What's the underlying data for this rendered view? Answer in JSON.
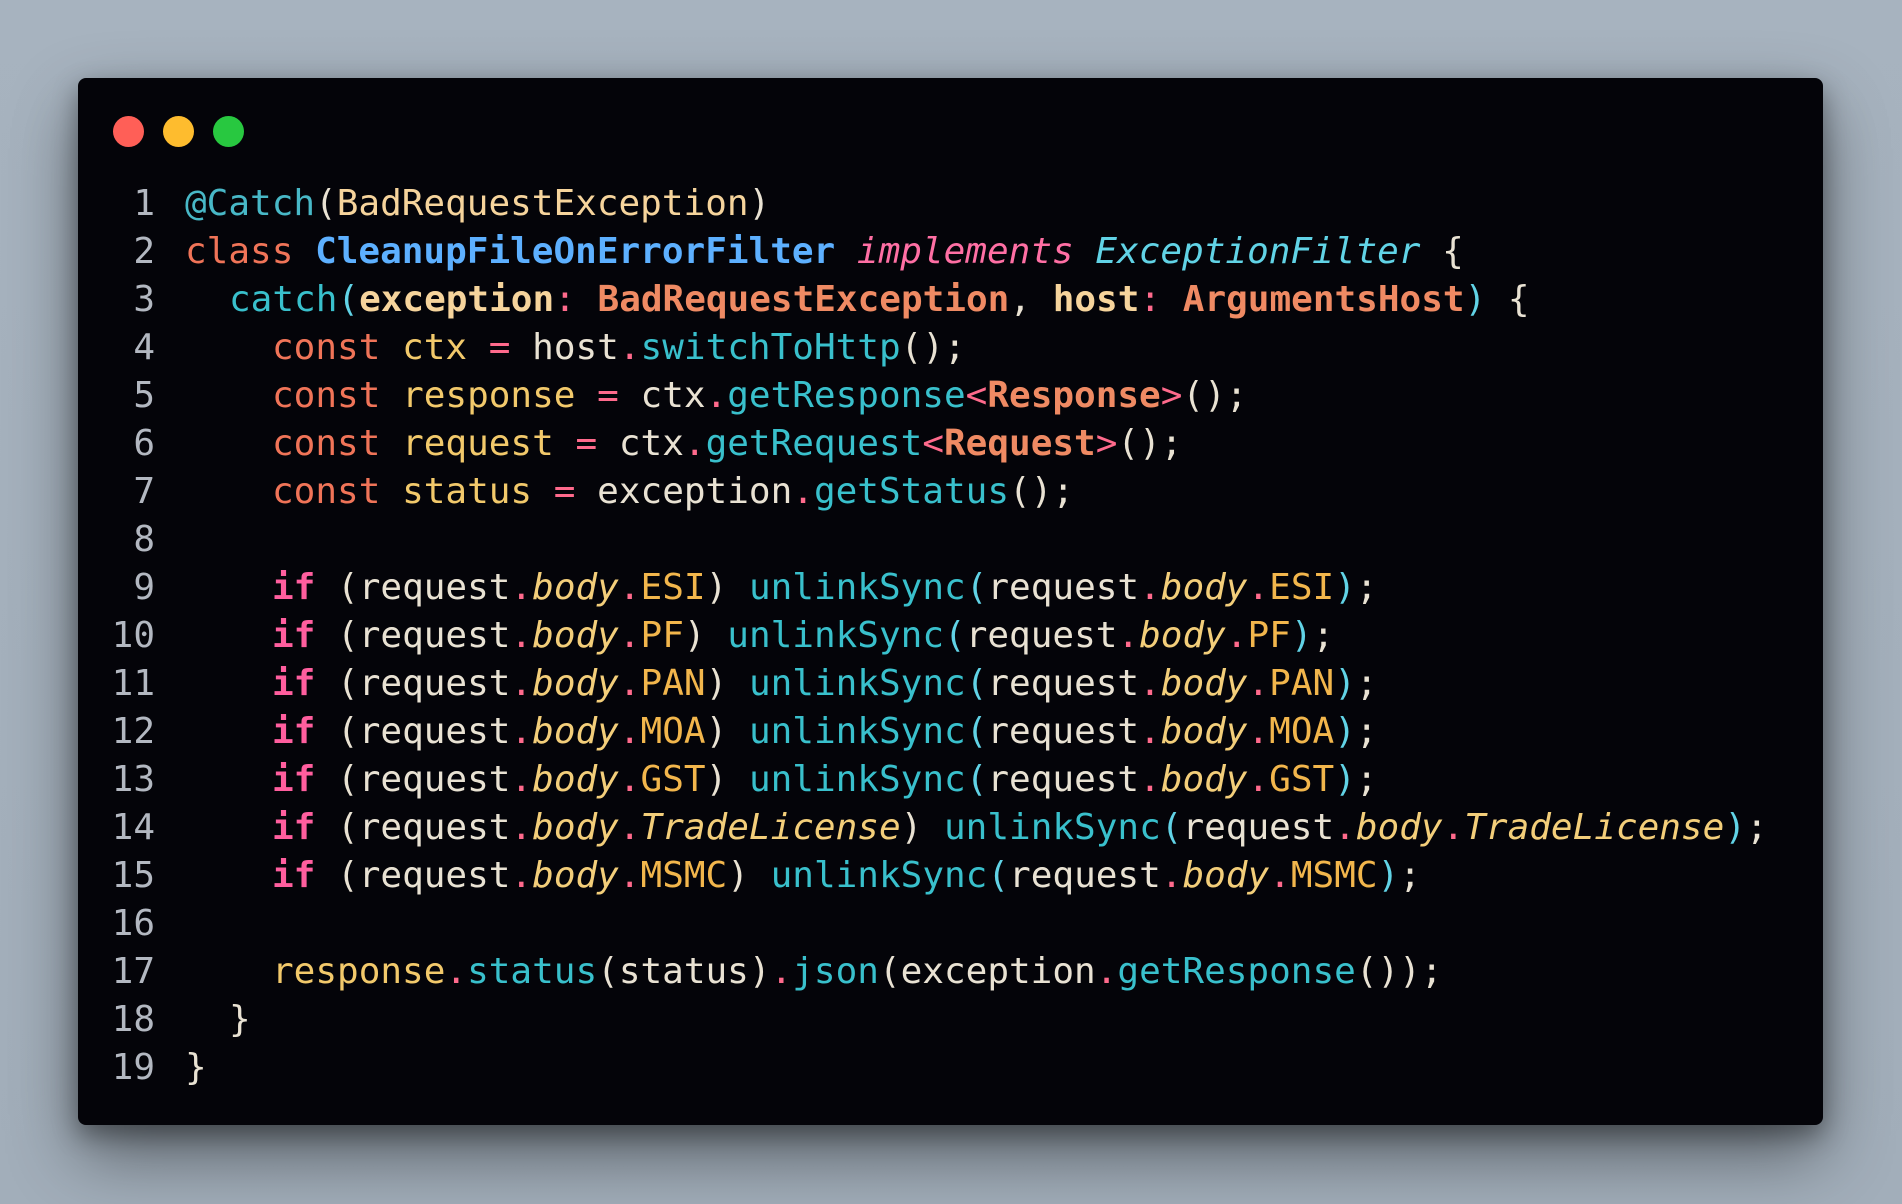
{
  "window": {
    "traffic_lights": {
      "close_color": "#ff5f57",
      "minimize_color": "#febc2e",
      "maximize_color": "#28c840"
    }
  },
  "code": {
    "line_numbers": [
      "1",
      "2",
      "3",
      "4",
      "5",
      "6",
      "7",
      "8",
      "9",
      "10",
      "11",
      "12",
      "13",
      "14",
      "15",
      "16",
      "17",
      "18",
      "19"
    ],
    "tokens": {
      "decorator": "@Catch",
      "decorator_arg": "BadRequestException",
      "kw_class": "class",
      "class_name": "CleanupFileOnErrorFilter",
      "kw_implements": "implements",
      "interface_name": "ExceptionFilter",
      "method_catch": "catch",
      "param_exception": "exception",
      "type_bad_request": "BadRequestException",
      "param_host": "host",
      "type_arguments_host": "ArgumentsHost",
      "kw_const": "const",
      "var_ctx": "ctx",
      "var_host": "host",
      "fn_switch_to_http": "switchToHttp",
      "var_response": "response",
      "fn_get_response": "getResponse",
      "type_response": "Response",
      "var_request": "request",
      "fn_get_request": "getRequest",
      "type_request": "Request",
      "var_status": "status",
      "var_exception": "exception",
      "fn_get_status": "getStatus",
      "kw_if": "if",
      "prop_body": "body",
      "fn_unlink_sync": "unlinkSync",
      "fn_status": "status",
      "fn_json": "json"
    },
    "fields": [
      "ESI",
      "PF",
      "PAN",
      "MOA",
      "GST",
      "TradeLicense",
      "MSMC"
    ]
  }
}
